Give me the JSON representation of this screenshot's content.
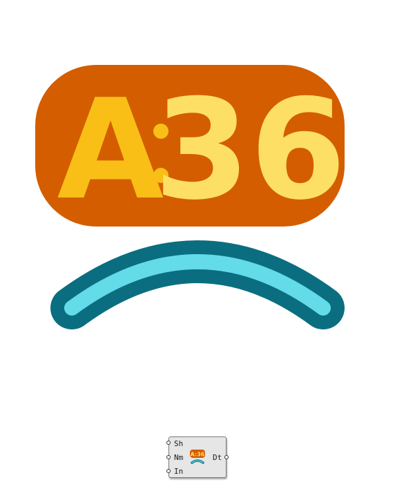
{
  "icon": {
    "badge_letter": "A",
    "badge_colon": ":",
    "badge_number": "36",
    "colors": {
      "badge_bg": "#d45d00",
      "letter": "#f9bf17",
      "number": "#fddf65",
      "arc_outer": "#0a6e80",
      "arc_inner": "#63dbe8"
    }
  },
  "component": {
    "inputs": [
      "Sh",
      "Nm",
      "In"
    ],
    "output": "Dt",
    "icon_name": "number-badge-arc-icon"
  }
}
